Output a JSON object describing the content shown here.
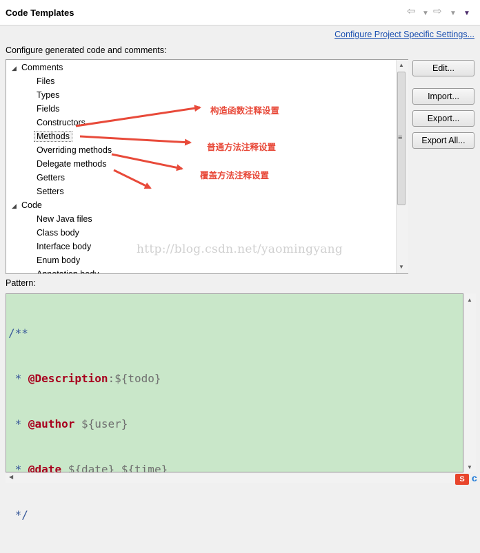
{
  "header": {
    "title": "Code Templates"
  },
  "configure_link": "Configure Project Specific Settings...",
  "section_label": "Configure generated code and comments:",
  "tree": {
    "comments": {
      "label": "Comments",
      "children": [
        "Files",
        "Types",
        "Fields",
        "Constructors",
        "Methods",
        "Overriding methods",
        "Delegate methods",
        "Getters",
        "Setters"
      ]
    },
    "code": {
      "label": "Code",
      "children": [
        "New Java files",
        "Class body",
        "Interface body",
        "Enum body",
        "Annotation body"
      ]
    },
    "selected": "Methods"
  },
  "buttons": {
    "edit": "Edit...",
    "import": "Import...",
    "export": "Export...",
    "export_all": "Export All..."
  },
  "pattern_label": "Pattern:",
  "pattern": {
    "open": "/**",
    "line1": {
      "prefix": " * ",
      "tag": "@Description",
      "rest": ":${todo}"
    },
    "line2": {
      "prefix": " * ",
      "tag": "@author",
      "rest": " ${user}"
    },
    "line3": {
      "prefix": " * ",
      "tag": "@date",
      "rest": " ${date} ${time}"
    },
    "close": " */"
  },
  "annotations": {
    "constructor": "构造函数注释设置",
    "method": "普通方法注释设置",
    "override": "覆盖方法注释设置"
  },
  "watermark": "http://blog.csdn.net/yaomingyang",
  "ime_label": "S",
  "colors": {
    "annotation": "#e84a3a",
    "editor_bg": "#c9e7c9",
    "link": "#1a4fb0",
    "keyword": "#a8001e"
  },
  "icons": [
    "back-arrow-icon",
    "forward-arrow-icon",
    "dropdown-icon",
    "view-menu-icon",
    "collapse-triangle-icon",
    "scroll-up-icon",
    "scroll-down-icon",
    "scroll-grip-icon"
  ]
}
